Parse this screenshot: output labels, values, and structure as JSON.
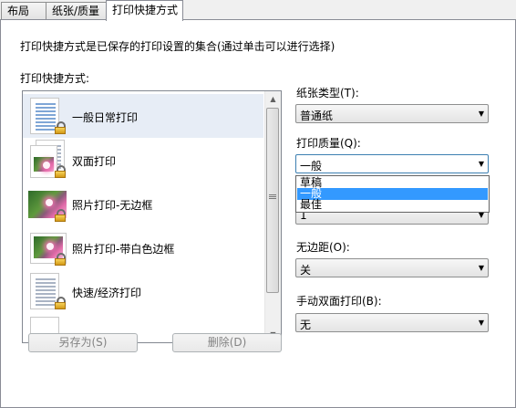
{
  "tabs": [
    "布局",
    "纸张/质量",
    "打印快捷方式"
  ],
  "description": "打印快捷方式是已保存的打印设置的集合(通过单击可以进行选择)",
  "list_label": "打印快捷方式:",
  "presets": [
    {
      "label": "一般日常打印",
      "icon": "document-icon",
      "selected": true
    },
    {
      "label": "双面打印",
      "icon": "duplex-icon",
      "selected": false
    },
    {
      "label": "照片打印-无边框",
      "icon": "photo-borderless-icon",
      "selected": false
    },
    {
      "label": "照片打印-带白色边框",
      "icon": "photo-border-icon",
      "selected": false
    },
    {
      "label": "快速/经济打印",
      "icon": "economy-icon",
      "selected": false
    }
  ],
  "buttons": {
    "save_as": "另存为(S)",
    "delete": "删除(D)"
  },
  "paper_type": {
    "label": "纸张类型(T):",
    "value": "普通纸"
  },
  "print_quality": {
    "label": "打印质量(Q):",
    "value": "一般",
    "options": [
      "草稿",
      "一般",
      "最佳"
    ],
    "highlighted": "一般"
  },
  "hidden_combo": {
    "value": "1"
  },
  "borderless": {
    "label": "无边距(O):",
    "value": "关"
  },
  "manual_duplex": {
    "label": "手动双面打印(B):",
    "value": "无"
  },
  "colors": {
    "selected_row": "#e7edf6",
    "highlight": "#3399ff"
  }
}
